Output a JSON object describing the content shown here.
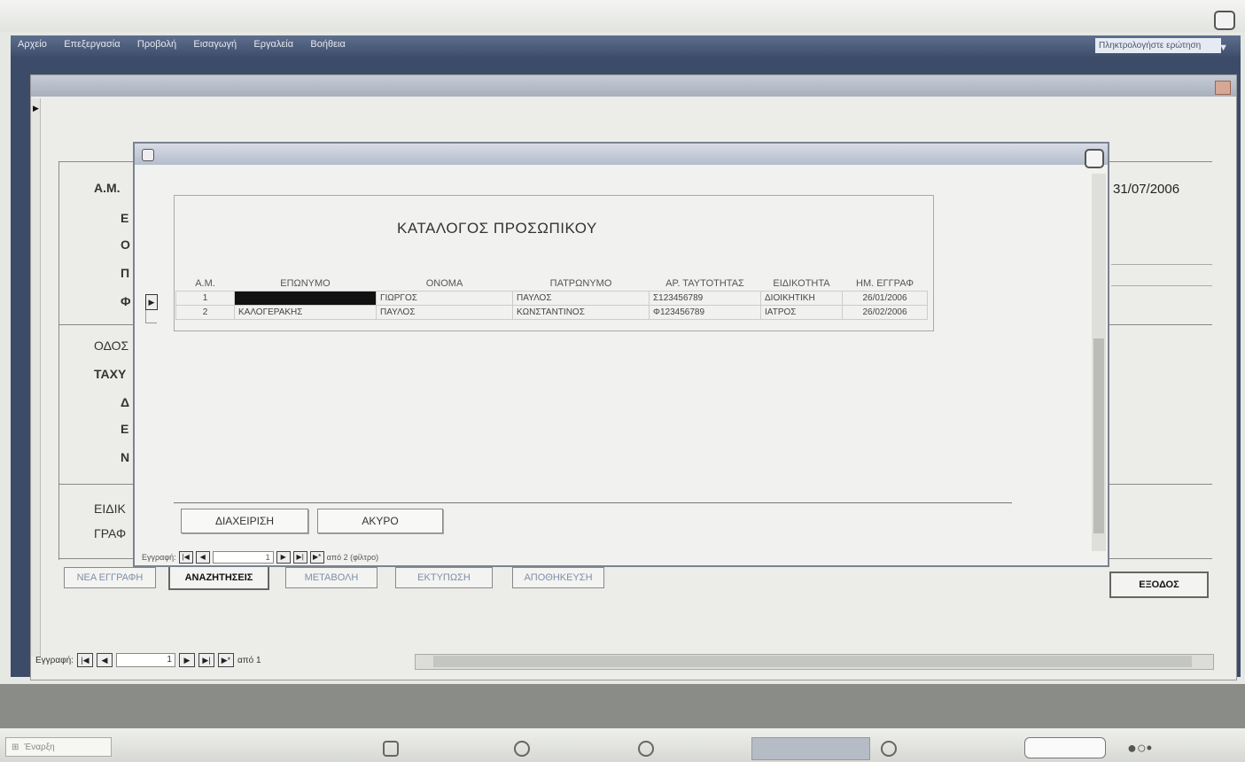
{
  "menu": [
    "Αρχείο",
    "Επεξεργασία",
    "Προβολή",
    "Εισαγωγή",
    "Εργαλεία",
    "Βοήθεια"
  ],
  "help_box": "Πληκτρολογήστε ερώτηση",
  "main_form": {
    "labels": [
      "Α.Μ.",
      "Ε",
      "Ο",
      "Π",
      "Φ",
      "ΟΔΟΣ",
      "ΤΑΧΥ",
      "Δ",
      "Ε",
      "Ν",
      "ΕΙΔΙΚ",
      "ΓΡΑΦ"
    ],
    "date_value": "31/07/2006",
    "buttons": {
      "new": "ΝΕΑ ΕΓΓΡΑΦΗ",
      "search": "ΑΝΑΖΗΤΗΣΕΙΣ",
      "update": "ΜΕΤΑΒΟΛΗ",
      "print": "ΕΚΤΥΠΩΣΗ",
      "save": "ΑΠΟΘΗΚΕΥΣΗ",
      "exit": "ΕΞΟΔΟΣ"
    },
    "nav": {
      "label": "Εγγραφή:",
      "current": "1",
      "total_text": "από 1"
    }
  },
  "dialog": {
    "title": "ΚΑΤΑΛΟΓΟΣ ΠΡΟΣΩΠΙΚΟΥ",
    "columns": [
      "Α.Μ.",
      "ΕΠΩΝΥΜΟ",
      "ΟΝΟΜΑ",
      "ΠΑΤΡΩΝΥΜΟ",
      "ΑΡ. ΤΑΥΤΟΤΗΤΑΣ",
      "ΕΙΔΙΚΟΤΗΤΑ",
      "ΗΜ. ΕΓΓΡΑΦ"
    ],
    "rows": [
      {
        "am": "1",
        "surname": "",
        "name": "ΓΙΩΡΓΟΣ",
        "father": "ΠΑΥΛΟΣ",
        "id": "Σ123456789",
        "specialty": "ΔΙΟΙΚΗΤΙΚΗ",
        "date": "26/01/2006"
      },
      {
        "am": "2",
        "surname": "ΚΑΛΟΓΕΡΑΚΗΣ",
        "name": "ΠΑΥΛΟΣ",
        "father": "ΚΩΝΣΤΑΝΤΙΝΟΣ",
        "id": "Φ123456789",
        "specialty": "ΙΑΤΡΟΣ",
        "date": "26/02/2006"
      }
    ],
    "buttons": {
      "manage": "ΔΙΑΧΕΙΡΙΣΗ",
      "cancel": "ΑΚΥΡΟ"
    },
    "nav": {
      "label": "Εγγραφή:",
      "current": "1",
      "total_text": "από 2 (φίλτρο)"
    }
  },
  "taskbar": {
    "start": "Έναρξη"
  }
}
